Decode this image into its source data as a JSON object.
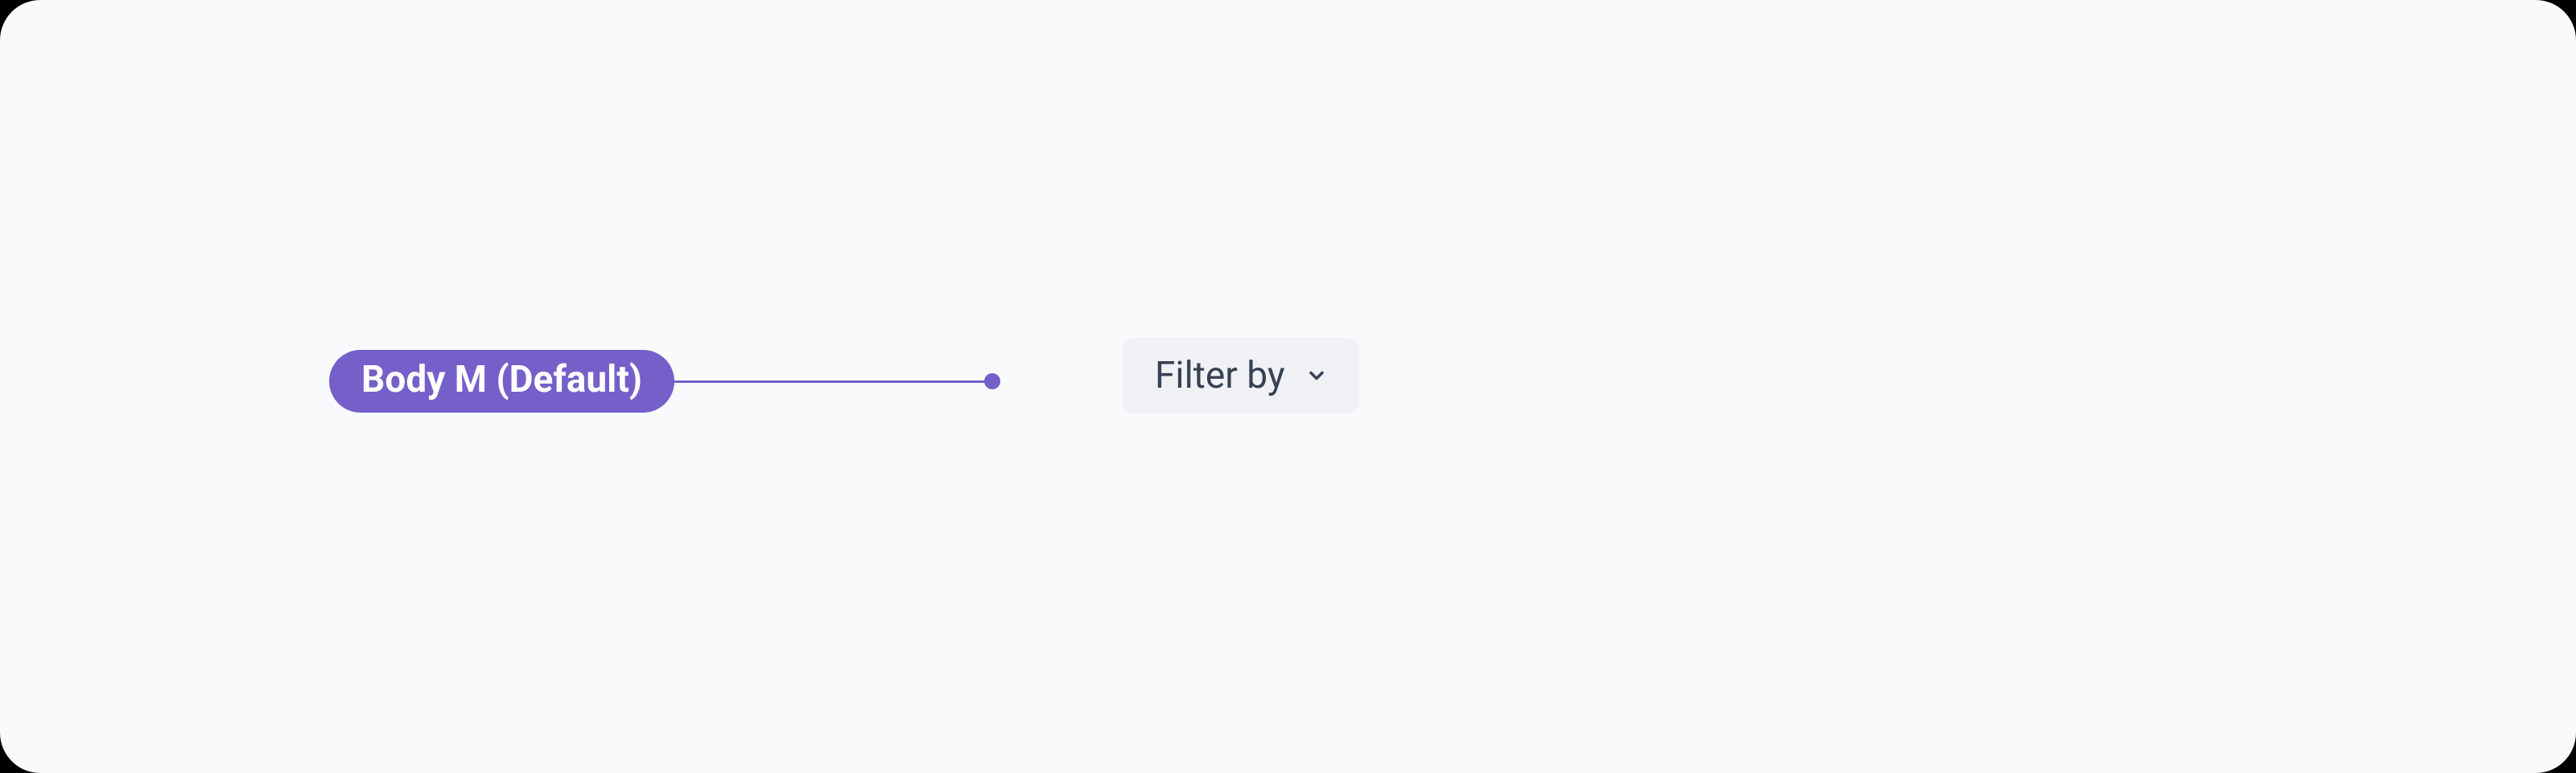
{
  "annotation": {
    "label": "Body M (Default)",
    "color": "#7560c9"
  },
  "target": {
    "label": "Filter by",
    "icon_name": "chevron-down-icon"
  }
}
